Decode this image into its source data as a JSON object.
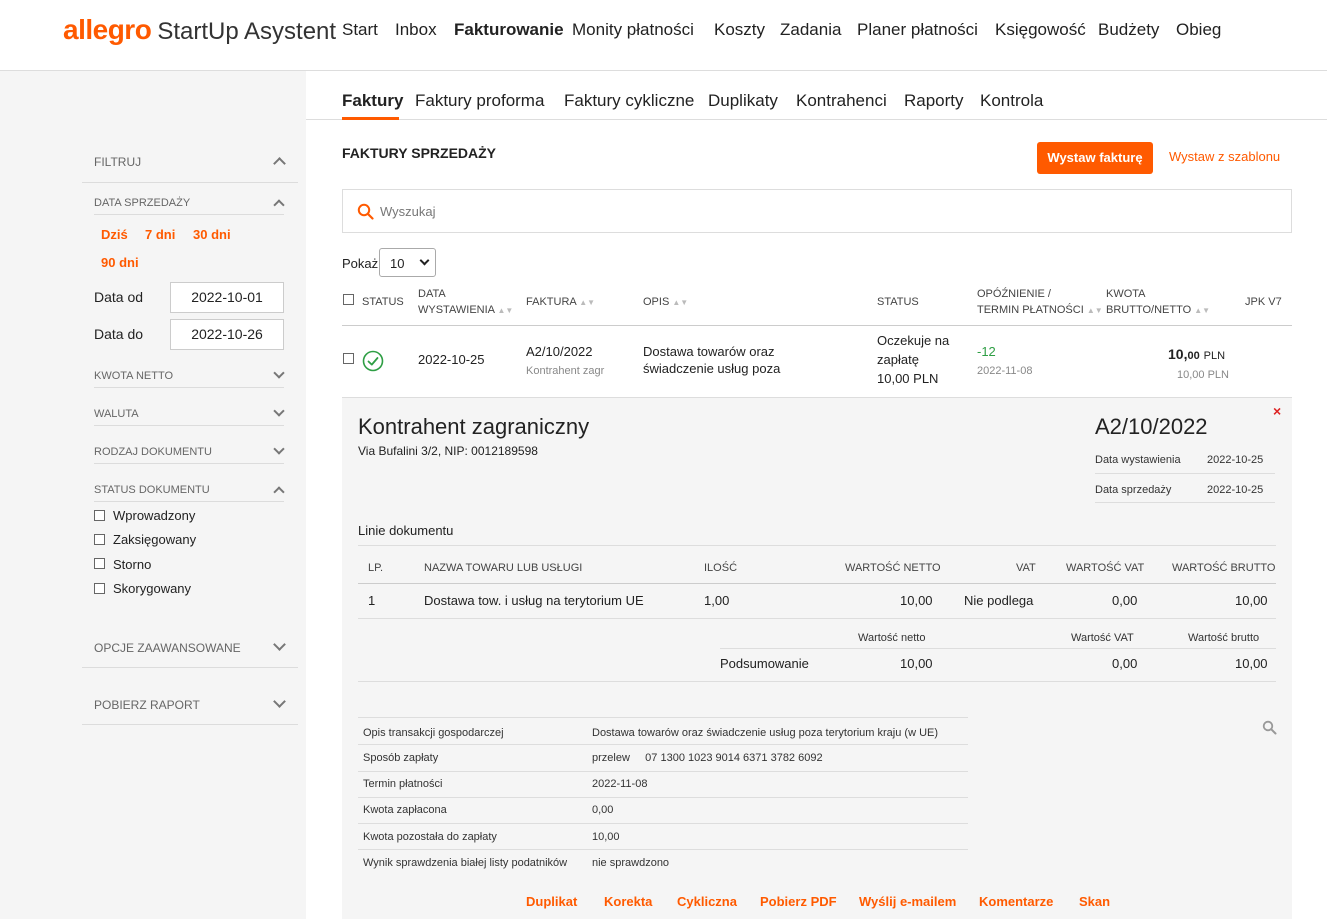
{
  "app": {
    "brand": "allegro",
    "product": "StartUp Asystent"
  },
  "topnav": [
    "Start",
    "Inbox",
    "Fakturowanie",
    "Monity płatności",
    "Koszty",
    "Zadania",
    "Planer płatności",
    "Księgowość",
    "Budżety",
    "Obieg"
  ],
  "topnav_active": "Fakturowanie",
  "subnav": [
    "Faktury",
    "Faktury proforma",
    "Faktury cykliczne",
    "Duplikaty",
    "Kontrahenci",
    "Raporty",
    "Kontrola"
  ],
  "subnav_active": "Faktury",
  "sidebar": {
    "filter_title": "FILTRUJ",
    "sale_date": "DATA SPRZEDAŻY",
    "quick": [
      "Dziś",
      "7 dni",
      "30 dni",
      "90 dni"
    ],
    "date_from_label": "Data od",
    "date_from": "2022-10-01",
    "date_to_label": "Data do",
    "date_to": "2022-10-26",
    "net_amount": "KWOTA NETTO",
    "currency": "WALUTA",
    "doc_type": "RODZAJ DOKUMENTU",
    "doc_status": "STATUS DOKUMENTU",
    "statuses": [
      "Wprowadzony",
      "Zaksięgowany",
      "Storno",
      "Skorygowany"
    ],
    "advanced": "OPCJE ZAAWANSOWANE",
    "report": "POBIERZ RAPORT"
  },
  "section_title": "FAKTURY SPRZEDAŻY",
  "buttons": {
    "issue": "Wystaw fakturę",
    "template": "Wystaw z szablonu"
  },
  "search": {
    "placeholder": "Wyszukaj"
  },
  "show": {
    "label": "Pokaż",
    "value": "10"
  },
  "table": {
    "headers": {
      "status": "STATUS",
      "date1": "DATA",
      "date2": "WYSTAWIENIA",
      "invoice": "FAKTURA",
      "desc": "OPIS",
      "status2": "STATUS",
      "delay1": "OPÓŹNIENIE /",
      "delay2": "TERMIN PŁATNOŚCI",
      "amount1": "KWOTA",
      "amount2": "BRUTTO/NETTO",
      "jpk": "JPK V7"
    },
    "row": {
      "date": "2022-10-25",
      "invoice": "A2/10/2022",
      "contractor": "Kontrahent zagr",
      "desc1": "Dostawa towarów oraz",
      "desc2": "świadczenie usług poza",
      "status1": "Oczekuje na",
      "status2": "zapłatę",
      "status3": "10,00 PLN",
      "delay": "-12",
      "due": "2022-11-08",
      "gross_main": "10,",
      "gross_dec": "00",
      "gross_cur": "PLN",
      "net": "10,00 PLN"
    }
  },
  "detail": {
    "contractor": "Kontrahent zagraniczny",
    "address": "Via Bufalini 3/2, NIP: 0012189598",
    "invoice_no": "A2/10/2022",
    "issue_label": "Data wystawienia",
    "issue_date": "2022-10-25",
    "sale_label": "Data sprzedaży",
    "sale_date": "2022-10-25",
    "lines_title": "Linie dokumentu",
    "lines_headers": {
      "lp": "LP.",
      "name": "NAZWA TOWARU LUB USŁUGI",
      "qty": "ILOŚĆ",
      "net": "WARTOŚĆ NETTO",
      "vat": "VAT",
      "vat_val": "WARTOŚĆ VAT",
      "gross": "WARTOŚĆ BRUTTO"
    },
    "line": {
      "lp": "1",
      "name": "Dostawa tow. i usług na terytorium UE",
      "qty": "1,00",
      "net": "10,00",
      "vat": "Nie podlega",
      "vat_val": "0,00",
      "gross": "10,00"
    },
    "summary_headers": {
      "net": "Wartość netto",
      "vat": "Wartość VAT",
      "gross": "Wartość brutto"
    },
    "summary": {
      "label": "Podsumowanie",
      "net": "10,00",
      "vat": "0,00",
      "gross": "10,00"
    },
    "info": [
      {
        "k": "Opis transakcji gospodarczej",
        "v": "Dostawa towarów oraz świadczenie usług poza terytorium kraju (w UE)"
      },
      {
        "k": "Sposób zapłaty",
        "v": "przelew     07 1300 1023 9014 6371 3782 6092"
      },
      {
        "k": "Termin płatności",
        "v": "2022-11-08"
      },
      {
        "k": "Kwota zapłacona",
        "v": "0,00"
      },
      {
        "k": "Kwota pozostała do zapłaty",
        "v": "10,00"
      },
      {
        "k": "Wynik sprawdzenia białej listy podatników",
        "v": "nie sprawdzono"
      }
    ],
    "actions": [
      "Duplikat",
      "Korekta",
      "Cykliczna",
      "Pobierz PDF",
      "Wyślij e-mailem",
      "Komentarze",
      "Skan"
    ]
  },
  "colors": {
    "accent": "#ff5a00",
    "ok": "#2e9e44"
  }
}
